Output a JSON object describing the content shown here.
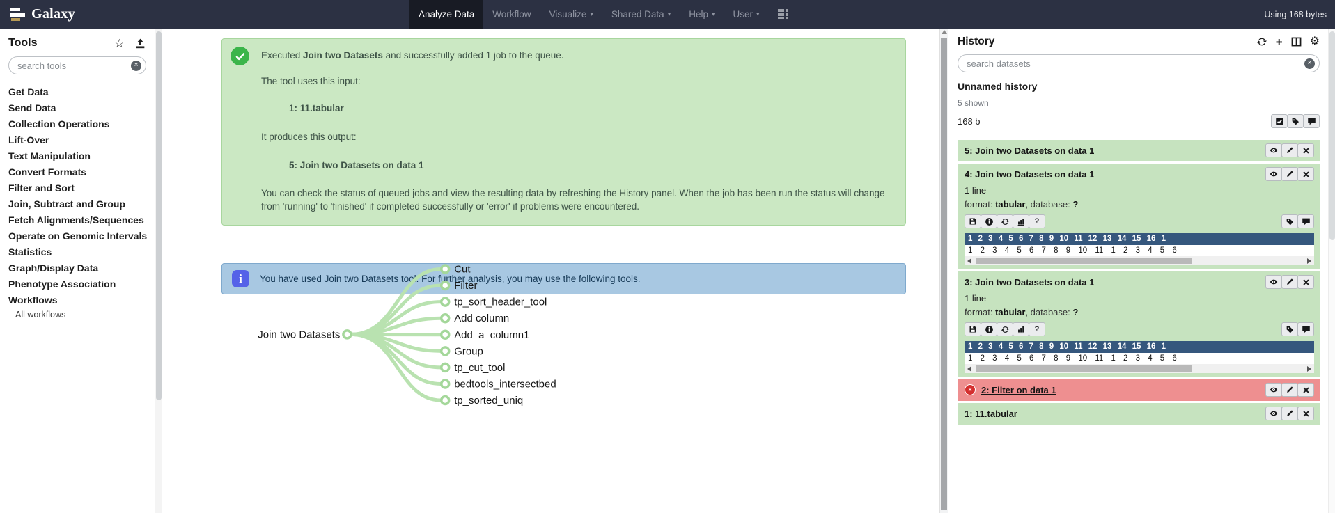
{
  "navbar": {
    "brand": "Galaxy",
    "items": [
      {
        "label": "Analyze Data",
        "active": true
      },
      {
        "label": "Workflow",
        "active": false
      },
      {
        "label": "Visualize",
        "active": false
      },
      {
        "label": "Shared Data",
        "active": false
      },
      {
        "label": "Help",
        "active": false
      },
      {
        "label": "User",
        "active": false
      }
    ],
    "usage": "Using 168 bytes"
  },
  "tools": {
    "title": "Tools",
    "search_placeholder": "search tools",
    "categories": [
      "Get Data",
      "Send Data",
      "Collection Operations",
      "Lift-Over",
      "Text Manipulation",
      "Convert Formats",
      "Filter and Sort",
      "Join, Subtract and Group",
      "Fetch Alignments/Sequences",
      "Operate on Genomic Intervals",
      "Statistics",
      "Graph/Display Data",
      "Phenotype Association",
      "Workflows"
    ],
    "all_workflows": "All workflows"
  },
  "messages": {
    "success": {
      "exec_pre": "Executed ",
      "exec_bold": "Join two Datasets",
      "exec_post": " and successfully added 1 job to the queue.",
      "uses_input": "The tool uses this input:",
      "input_name": "1: 11.tabular",
      "produces_output": "It produces this output:",
      "output_name": "5: Join two Datasets on data 1",
      "note": "You can check the status of queued jobs and view the resulting data by refreshing the History panel. When the job has been run the status will change from 'running' to 'finished' if completed successfully or 'error' if problems were encountered."
    },
    "info": "You have used Join two Datasets tool. For further analysis, you may use the following tools."
  },
  "tree": {
    "root": "Join two Datasets",
    "leaves": [
      "Cut",
      "Filter",
      "tp_sort_header_tool",
      "Add column",
      "Add_a_column1",
      "Group",
      "tp_cut_tool",
      "bedtools_intersectbed",
      "tp_sorted_uniq"
    ]
  },
  "history": {
    "title": "History",
    "search_placeholder": "search datasets",
    "name": "Unnamed history",
    "shown": "5 shown",
    "size": "168 b",
    "items": [
      {
        "title": "5: Join two Datasets on data 1",
        "state": "ok"
      },
      {
        "title": "4: Join two Datasets on data 1",
        "state": "ok",
        "lines": "1 line",
        "format_label": "format: ",
        "format": "tabular",
        "db_label": ", database: ",
        "database": "?",
        "preview_header": "1 2 3 4 5 6 7 8 9 10 11 12 13 14 15 16 1",
        "preview_row": "1 2 3 4 5 6 7 8 9 10 11 1 2 3 4 5 6"
      },
      {
        "title": "3: Join two Datasets on data 1",
        "state": "ok",
        "lines": "1 line",
        "format_label": "format: ",
        "format": "tabular",
        "db_label": ", database: ",
        "database": "?",
        "preview_header": "1 2 3 4 5 6 7 8 9 10 11 12 13 14 15 16 1",
        "preview_row": "1 2 3 4 5 6 7 8 9 10 11 1 2 3 4 5 6"
      },
      {
        "title": "2: Filter on data 1",
        "state": "error"
      },
      {
        "title": "1: 11.tabular",
        "state": "ok"
      }
    ]
  },
  "icons": {
    "galaxy-logo-icon": "stacked bars",
    "search-clear-icon": "circled x",
    "star-icon": "☆",
    "upload-icon": "arrow into tray",
    "caret-down-icon": "▾",
    "grid-icon": "3x3 squares",
    "success-check-icon": "white check in green circle",
    "info-icon": "white i in blue square",
    "refresh-icon": "two circular arrows",
    "plus-icon": "+",
    "columns-icon": "split window",
    "gear-icon": "⚙",
    "check-square-icon": "checked box",
    "tags-icon": "price tag",
    "comment-icon": "speech bubble",
    "eye-icon": "eye",
    "pencil-icon": "pencil",
    "delete-x-icon": "x",
    "save-icon": "floppy disk",
    "info-circle-icon": "i in circle",
    "chart-icon": "bar chart",
    "question-icon": "?"
  },
  "colors": {
    "navbar_bg": "#2c3143",
    "navbar_active_bg": "#181b24",
    "success_bg": "#cbe8c3",
    "success_border": "#a8d69e",
    "success_accent": "#3bb54a",
    "info_bg": "#a8c8e2",
    "info_border": "#7fa9cd",
    "info_accent": "#5562e8",
    "tree_link": "#b9e2b0",
    "state_ok_bg": "#c6e3bf",
    "state_error_bg": "#ee8f90",
    "error_accent": "#d42f2f",
    "preview_header_bg": "#35577d"
  }
}
